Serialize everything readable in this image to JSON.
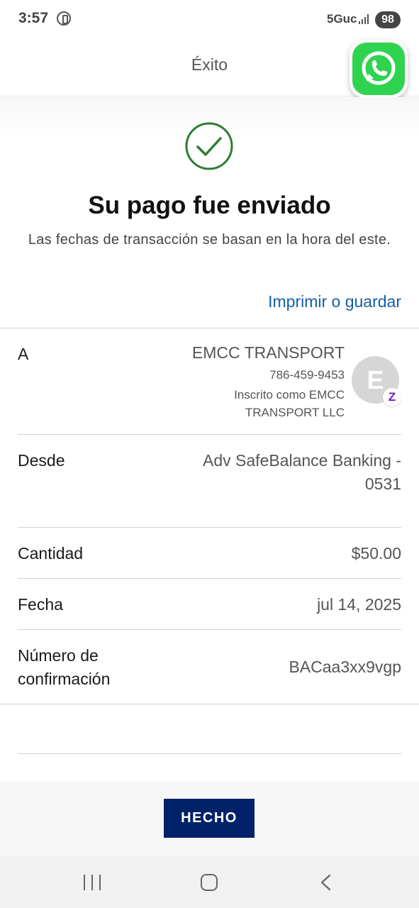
{
  "status_bar": {
    "time": "3:57",
    "network": "5Guc",
    "battery": "98"
  },
  "header": {
    "title": "Éxito"
  },
  "success": {
    "title": "Su pago fue enviado",
    "subtitle": "Las fechas de transacción se basan en la hora del este.",
    "print_link": "Imprimir o guardar"
  },
  "details": {
    "recipient": {
      "label": "A",
      "name": "EMCC TRANSPORT",
      "phone": "786-459-9453",
      "registered_as": "Inscrito como EMCC TRANSPORT LLC",
      "avatar_letter": "E",
      "badge": "Z"
    },
    "from": {
      "label": "Desde",
      "value": "Adv SafeBalance Banking - 0531"
    },
    "amount": {
      "label": "Cantidad",
      "value": "$50.00"
    },
    "date": {
      "label": "Fecha",
      "value": "jul 14, 2025"
    },
    "confirmation": {
      "label": "Número de confirmación",
      "value": "BACaa3xx9vgp"
    }
  },
  "actions": {
    "done_label": "HECHO"
  },
  "colors": {
    "link": "#1460aa",
    "button": "#012169",
    "success_green": "#2e7d32",
    "zelle_purple": "#6d1ed4",
    "whatsapp_green": "#2fd34f"
  },
  "icons": {
    "success": "check-circle-icon",
    "whatsapp": "whatsapp-icon",
    "zelle": "zelle-icon"
  }
}
